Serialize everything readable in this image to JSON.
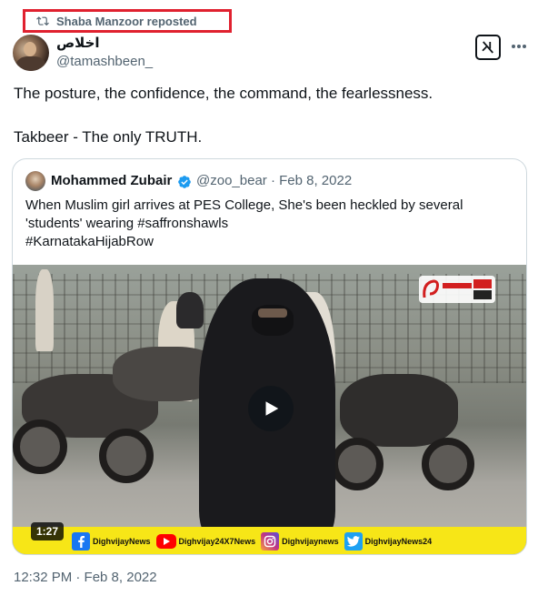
{
  "repost": {
    "label": "Shaba Manzoor reposted",
    "icon": "repost-icon"
  },
  "author": {
    "display_name": "اخلاص",
    "handle": "@tamashbeen_"
  },
  "actions": {
    "grok_icon": "grok-icon",
    "more_icon": "more-options-icon"
  },
  "tweet": {
    "line1": "The posture, the confidence, the command, the fearlessness.",
    "line2": "Takbeer - The only TRUTH."
  },
  "quote": {
    "display_name": "Mohammed Zubair",
    "handle_date": "@zoo_bear · Feb 8, 2022",
    "verified_icon": "verified-badge-icon",
    "text_line1": "When Muslim girl arrives at PES College, She's been heckled by several",
    "text_line2": "'students' wearing #saffronshawls",
    "text_line3": "#KarnatakaHijabRow",
    "video": {
      "duration": "1:27",
      "play_icon": "play-icon",
      "ticker": [
        {
          "icon": "facebook-icon",
          "label": "DighvijayNews",
          "color": "#1877f2"
        },
        {
          "icon": "youtube-icon",
          "label": "Dighvijay24X7News",
          "color": "#ff0000"
        },
        {
          "icon": "instagram-icon",
          "label": "Dighvijaynews",
          "color": "#c13584"
        },
        {
          "icon": "twitter-icon",
          "label": "DighvijayNews24",
          "color": "#1da1f2"
        }
      ]
    }
  },
  "timestamp": "12:32 PM · Feb 8, 2022",
  "colors": {
    "accent": "#1d9bf0",
    "secondary_text": "#536471",
    "highlight_box": "#e0212f",
    "ticker_bg": "#f7e617"
  }
}
